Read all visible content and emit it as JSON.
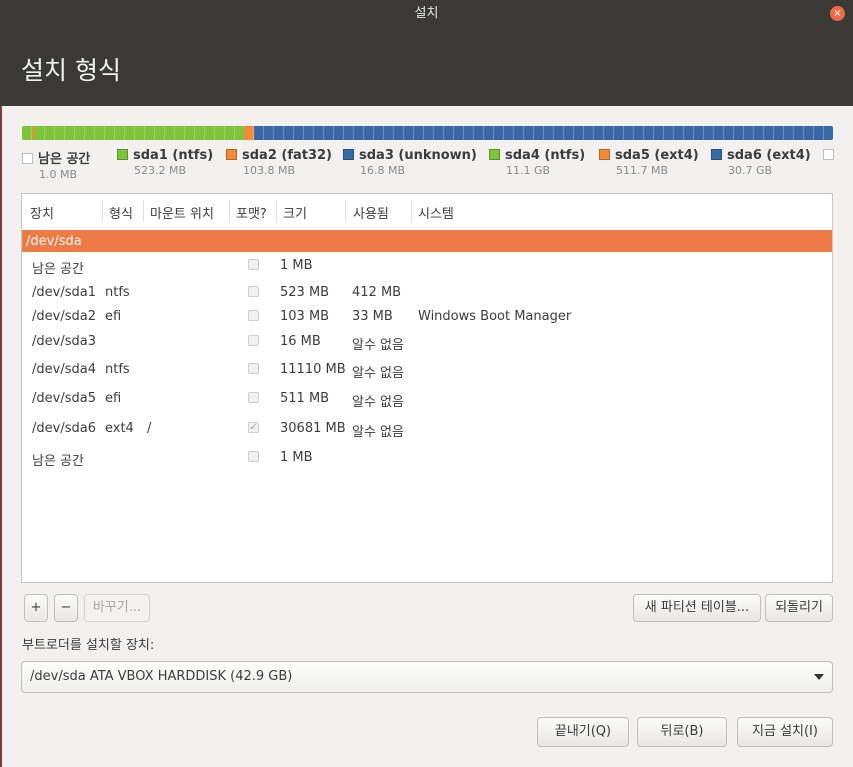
{
  "window": {
    "title": "설치",
    "close_glyph": "×"
  },
  "header": {
    "title": "설치 형식"
  },
  "partition_bar": {
    "segments": [
      {
        "name": "남은 공간",
        "color": "#ffffff",
        "fraction": 0.0003
      },
      {
        "name": "sda1",
        "color": "#7dc43b",
        "fraction": 0.0126
      },
      {
        "name": "sda2",
        "color": "#f28a38",
        "fraction": 0.0025
      },
      {
        "name": "sda3",
        "color": "#7dc43b",
        "fraction": 0.0005
      },
      {
        "name": "sda4",
        "color": "#7dc43b",
        "fraction": 0.2585
      },
      {
        "name": "sda5",
        "color": "#f28a38",
        "fraction": 0.0122
      },
      {
        "name": "sda6",
        "color": "#3b69a8",
        "fraction": 0.7134
      }
    ]
  },
  "legend": [
    {
      "name": "남은 공간",
      "size": "1.0 MB",
      "color": "#ffffff"
    },
    {
      "name": "sda1 (ntfs)",
      "size": "523.2 MB",
      "color": "#7dc43b"
    },
    {
      "name": "sda2 (fat32)",
      "size": "103.8 MB",
      "color": "#f28a38"
    },
    {
      "name": "sda3 (unknown)",
      "size": "16.8 MB",
      "color": "#3b69a8"
    },
    {
      "name": "sda4 (ntfs)",
      "size": "11.1 GB",
      "color": "#7dc43b"
    },
    {
      "name": "sda5 (ext4)",
      "size": "511.7 MB",
      "color": "#f28a38"
    },
    {
      "name": "sda6 (ext4)",
      "size": "30.7 GB",
      "color": "#3b69a8"
    },
    {
      "name": "",
      "size": "",
      "color": "#ffffff"
    }
  ],
  "table": {
    "headers": {
      "device": "장치",
      "type": "형식",
      "mount": "마운트 위치",
      "format": "포맷?",
      "size": "크기",
      "used": "사용됨",
      "system": "시스템"
    },
    "rows": [
      {
        "device": "/dev/sda",
        "type": "",
        "mount": "",
        "format": null,
        "size": "",
        "used": "",
        "system": "",
        "selected": true
      },
      {
        "device": "남은 공간",
        "type": "",
        "mount": "",
        "format": false,
        "size": "1 MB",
        "used": "",
        "system": ""
      },
      {
        "device": "/dev/sda1",
        "type": "ntfs",
        "mount": "",
        "format": false,
        "size": "523 MB",
        "used": "412 MB",
        "system": ""
      },
      {
        "device": "/dev/sda2",
        "type": "efi",
        "mount": "",
        "format": false,
        "size": "103 MB",
        "used": "33 MB",
        "system": "Windows Boot Manager"
      },
      {
        "device": "/dev/sda3",
        "type": "",
        "mount": "",
        "format": false,
        "size": "16 MB",
        "used": "알수 없음",
        "system": ""
      },
      {
        "device": "/dev/sda4",
        "type": "ntfs",
        "mount": "",
        "format": false,
        "size": "11110 MB",
        "used": "알수 없음",
        "system": ""
      },
      {
        "device": "/dev/sda5",
        "type": "efi",
        "mount": "",
        "format": false,
        "size": "511 MB",
        "used": "알수 없음",
        "system": ""
      },
      {
        "device": "/dev/sda6",
        "type": "ext4",
        "mount": "/",
        "format": true,
        "size": "30681 MB",
        "used": "알수 없음",
        "system": ""
      },
      {
        "device": "남은 공간",
        "type": "",
        "mount": "",
        "format": false,
        "size": "1 MB",
        "used": "",
        "system": ""
      }
    ]
  },
  "toolbar": {
    "add_label": "+",
    "remove_label": "−",
    "change_label": "바꾸기...",
    "new_table_label": "새 파티션 테이블...",
    "revert_label": "되돌리기"
  },
  "bootloader": {
    "label": "부트로더를 설치할 장치:",
    "value": "/dev/sda   ATA VBOX HARDDISK (42.9 GB)"
  },
  "footer": {
    "quit_label": "끝내기(Q)",
    "back_label": "뒤로(B)",
    "install_label": "지금 설치(I)"
  }
}
